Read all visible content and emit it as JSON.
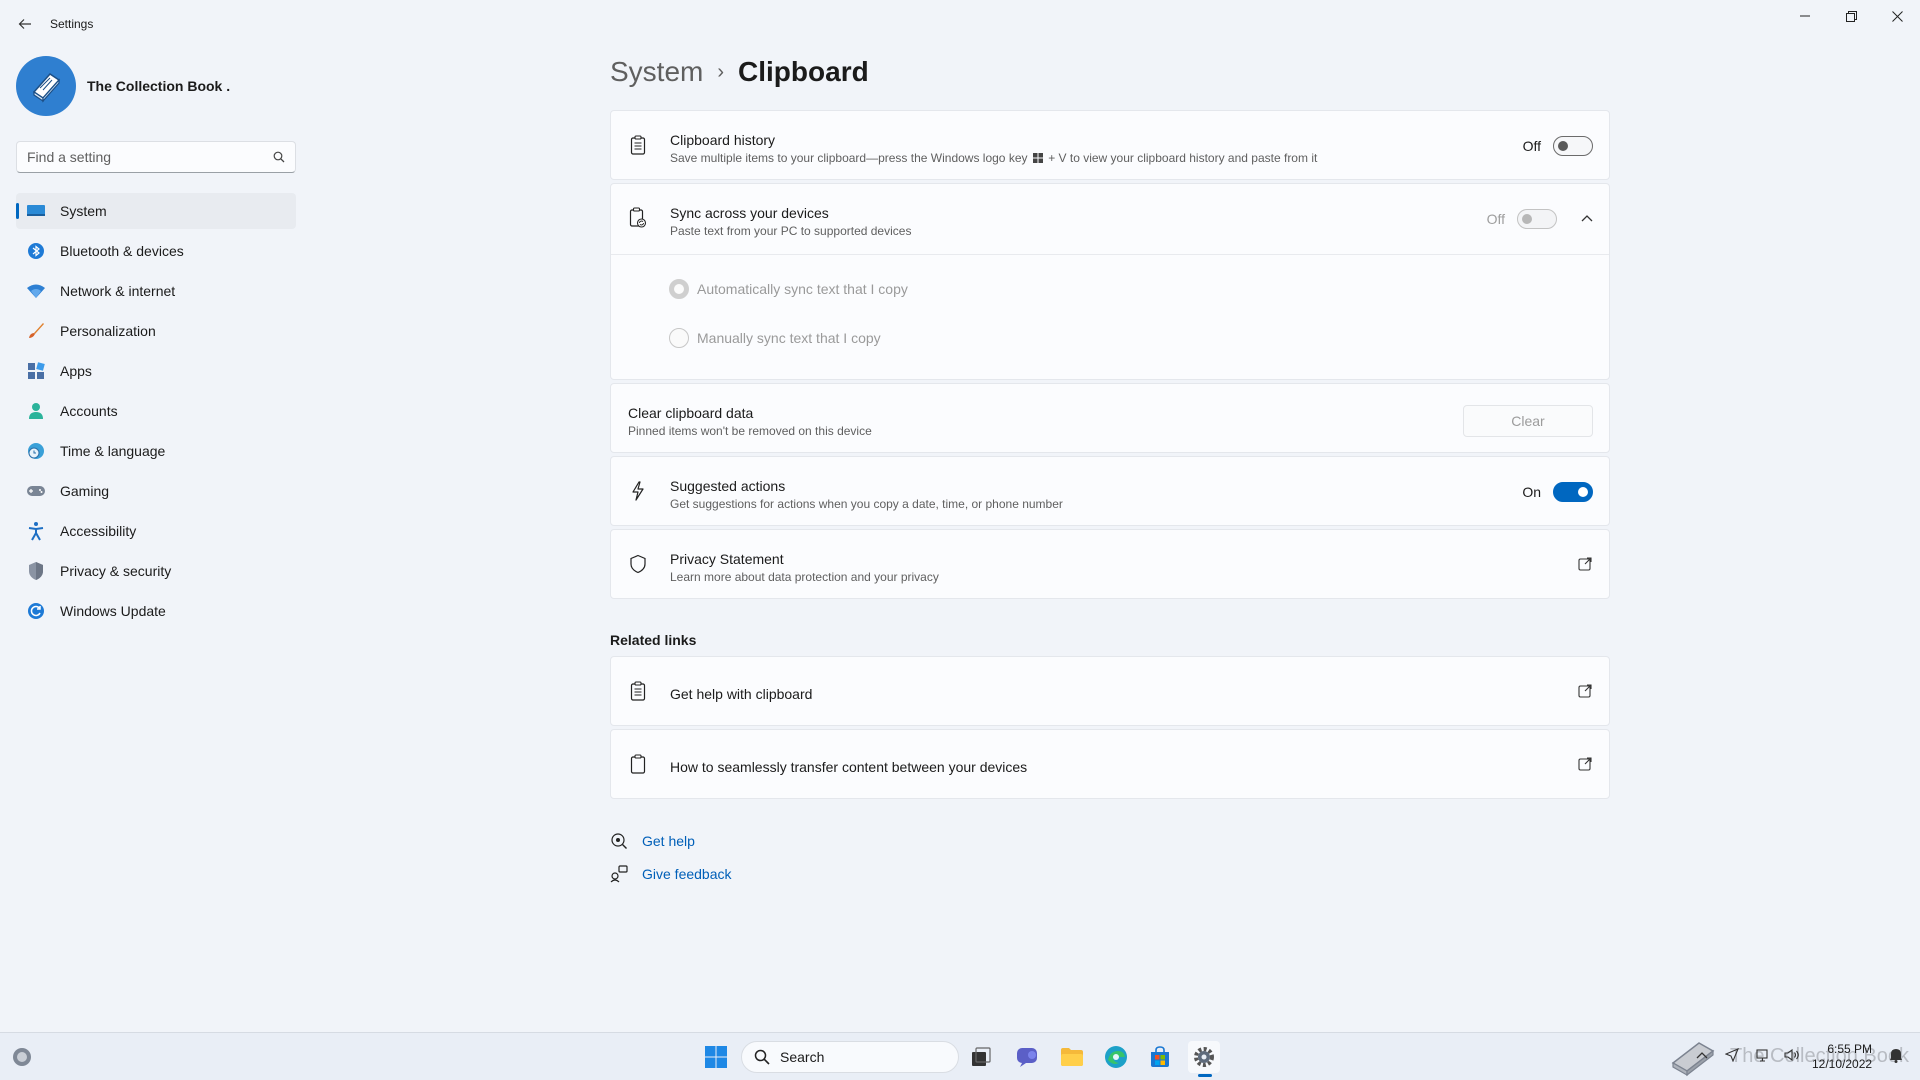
{
  "window": {
    "title": "Settings",
    "back_icon": "back-arrow-icon",
    "controls": [
      "minimize-icon",
      "maximize-icon",
      "close-icon"
    ]
  },
  "profile": {
    "name": "The Collection Book ."
  },
  "search": {
    "placeholder": "Find a setting"
  },
  "sidebar": {
    "items": [
      {
        "label": "System",
        "icon": "monitor-icon",
        "active": true
      },
      {
        "label": "Bluetooth & devices",
        "icon": "bluetooth-icon"
      },
      {
        "label": "Network & internet",
        "icon": "wifi-icon"
      },
      {
        "label": "Personalization",
        "icon": "brush-icon"
      },
      {
        "label": "Apps",
        "icon": "apps-icon"
      },
      {
        "label": "Accounts",
        "icon": "person-icon"
      },
      {
        "label": "Time & language",
        "icon": "globe-clock-icon"
      },
      {
        "label": "Gaming",
        "icon": "gamepad-icon"
      },
      {
        "label": "Accessibility",
        "icon": "accessibility-icon"
      },
      {
        "label": "Privacy & security",
        "icon": "shield-icon"
      },
      {
        "label": "Windows Update",
        "icon": "update-icon"
      }
    ]
  },
  "breadcrumb": {
    "parent": "System",
    "separator": "›",
    "current": "Clipboard"
  },
  "settings": {
    "clipboard_history": {
      "title": "Clipboard history",
      "subtitle_before": "Save multiple items to your clipboard—press the Windows logo key",
      "subtitle_after": "+ V to view your clipboard history and paste from it",
      "state": "Off"
    },
    "sync": {
      "title": "Sync across your devices",
      "subtitle": "Paste text from your PC to supported devices",
      "state": "Off",
      "options": [
        {
          "label": "Automatically sync text that I copy",
          "checked": true
        },
        {
          "label": "Manually sync text that I copy",
          "checked": false
        }
      ]
    },
    "clear": {
      "title": "Clear clipboard data",
      "subtitle": "Pinned items won't be removed on this device",
      "button": "Clear"
    },
    "suggested": {
      "title": "Suggested actions",
      "subtitle": "Get suggestions for actions when you copy a date, time, or phone number",
      "state": "On"
    },
    "privacy": {
      "title": "Privacy Statement",
      "subtitle": "Learn more about data protection and your privacy"
    }
  },
  "related": {
    "heading": "Related links",
    "links": [
      {
        "label": "Get help with clipboard",
        "icon": "clipboard-list-icon"
      },
      {
        "label": "How to seamlessly transfer content between your devices",
        "icon": "clipboard-icon"
      }
    ]
  },
  "help": {
    "get_help": "Get help",
    "give_feedback": "Give feedback"
  },
  "taskbar": {
    "search_label": "Search",
    "time": "6:55 PM",
    "date": "12/10/2022",
    "watermark": "The Collection Book"
  },
  "colors": {
    "accent": "#0067c0",
    "link": "#005fb8",
    "background": "#f1f4f9",
    "card": "#fbfcfe"
  }
}
